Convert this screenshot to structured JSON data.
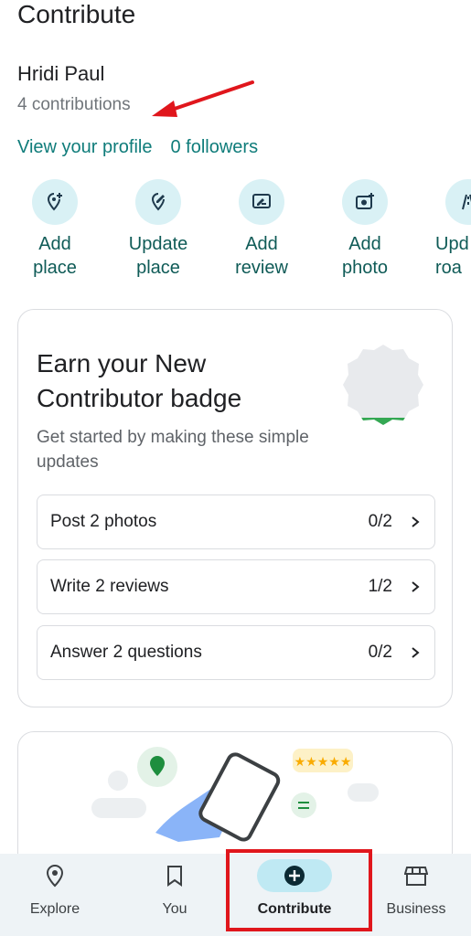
{
  "header": {
    "title": "Contribute"
  },
  "profile": {
    "name": "Hridi Paul",
    "contributions": "4 contributions",
    "view_profile": "View your profile",
    "followers": "0 followers"
  },
  "actions": [
    {
      "label": "Add\nplace",
      "icon": "add-place-icon"
    },
    {
      "label": "Update\nplace",
      "icon": "edit-place-icon"
    },
    {
      "label": "Add\nreview",
      "icon": "review-icon"
    },
    {
      "label": "Add\nphoto",
      "icon": "add-photo-icon"
    },
    {
      "label": "Upd\nroa",
      "icon": "road-icon"
    }
  ],
  "badge": {
    "title": "Earn your New Contributor badge",
    "subtitle": "Get started by making these simple updates",
    "tasks": [
      {
        "label": "Post 2 photos",
        "progress": "0/2"
      },
      {
        "label": "Write 2 reviews",
        "progress": "1/2"
      },
      {
        "label": "Answer 2 questions",
        "progress": "0/2"
      }
    ]
  },
  "promo": {
    "rating_stars": "★★★★★"
  },
  "nav": {
    "items": [
      {
        "label": "Explore",
        "icon": "location-pin-icon"
      },
      {
        "label": "You",
        "icon": "bookmark-icon"
      },
      {
        "label": "Contribute",
        "icon": "add-circle-icon"
      },
      {
        "label": "Business",
        "icon": "store-icon"
      }
    ],
    "active": "Contribute"
  },
  "colors": {
    "accent": "#0f7c7a",
    "annotation_red": "#e0161c",
    "nav_bg": "#eef3f6",
    "pill": "#bfe9f3"
  }
}
